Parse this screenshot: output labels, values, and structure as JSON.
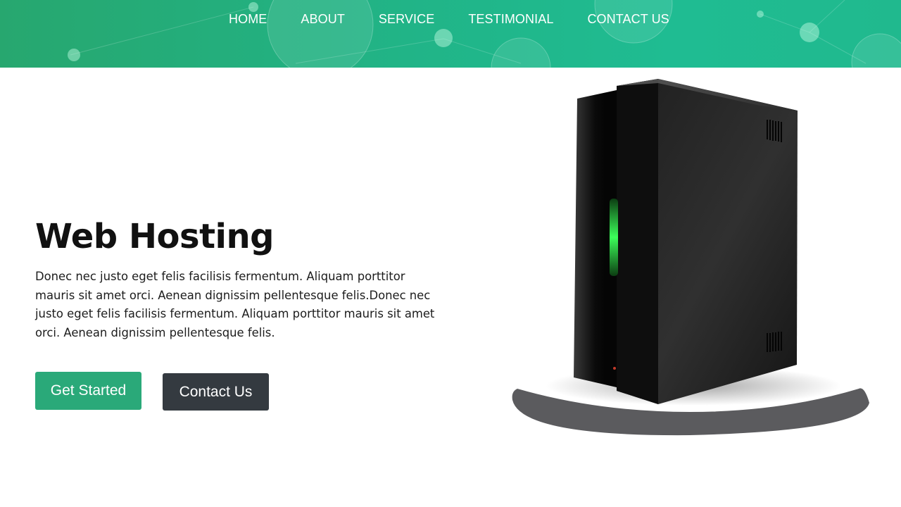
{
  "nav": {
    "items": [
      {
        "label": "HOME",
        "name": "nav-home"
      },
      {
        "label": "ABOUT",
        "name": "nav-about"
      },
      {
        "label": "SERVICE",
        "name": "nav-service"
      },
      {
        "label": "TESTIMONIAL",
        "name": "nav-testimonial"
      },
      {
        "label": "CONTACT US",
        "name": "nav-contact-us"
      }
    ]
  },
  "hero": {
    "title": "Web Hosting",
    "description": "Donec nec justo eget felis facilisis fermentum. Aliquam porttitor mauris sit amet orci. Aenean dignissim pellentesque felis.Donec nec justo eget felis facilisis fermentum. Aliquam porttitor mauris sit amet orci. Aenean dignissim pellentesque felis.",
    "primary_button": "Get Started",
    "secondary_button": "Contact Us"
  },
  "image": {
    "subject": "server-tower"
  },
  "colors": {
    "header": "#21b487",
    "primary_button": "#2aa979",
    "dark_button": "#343a40",
    "server_led": "#3cff5a"
  }
}
